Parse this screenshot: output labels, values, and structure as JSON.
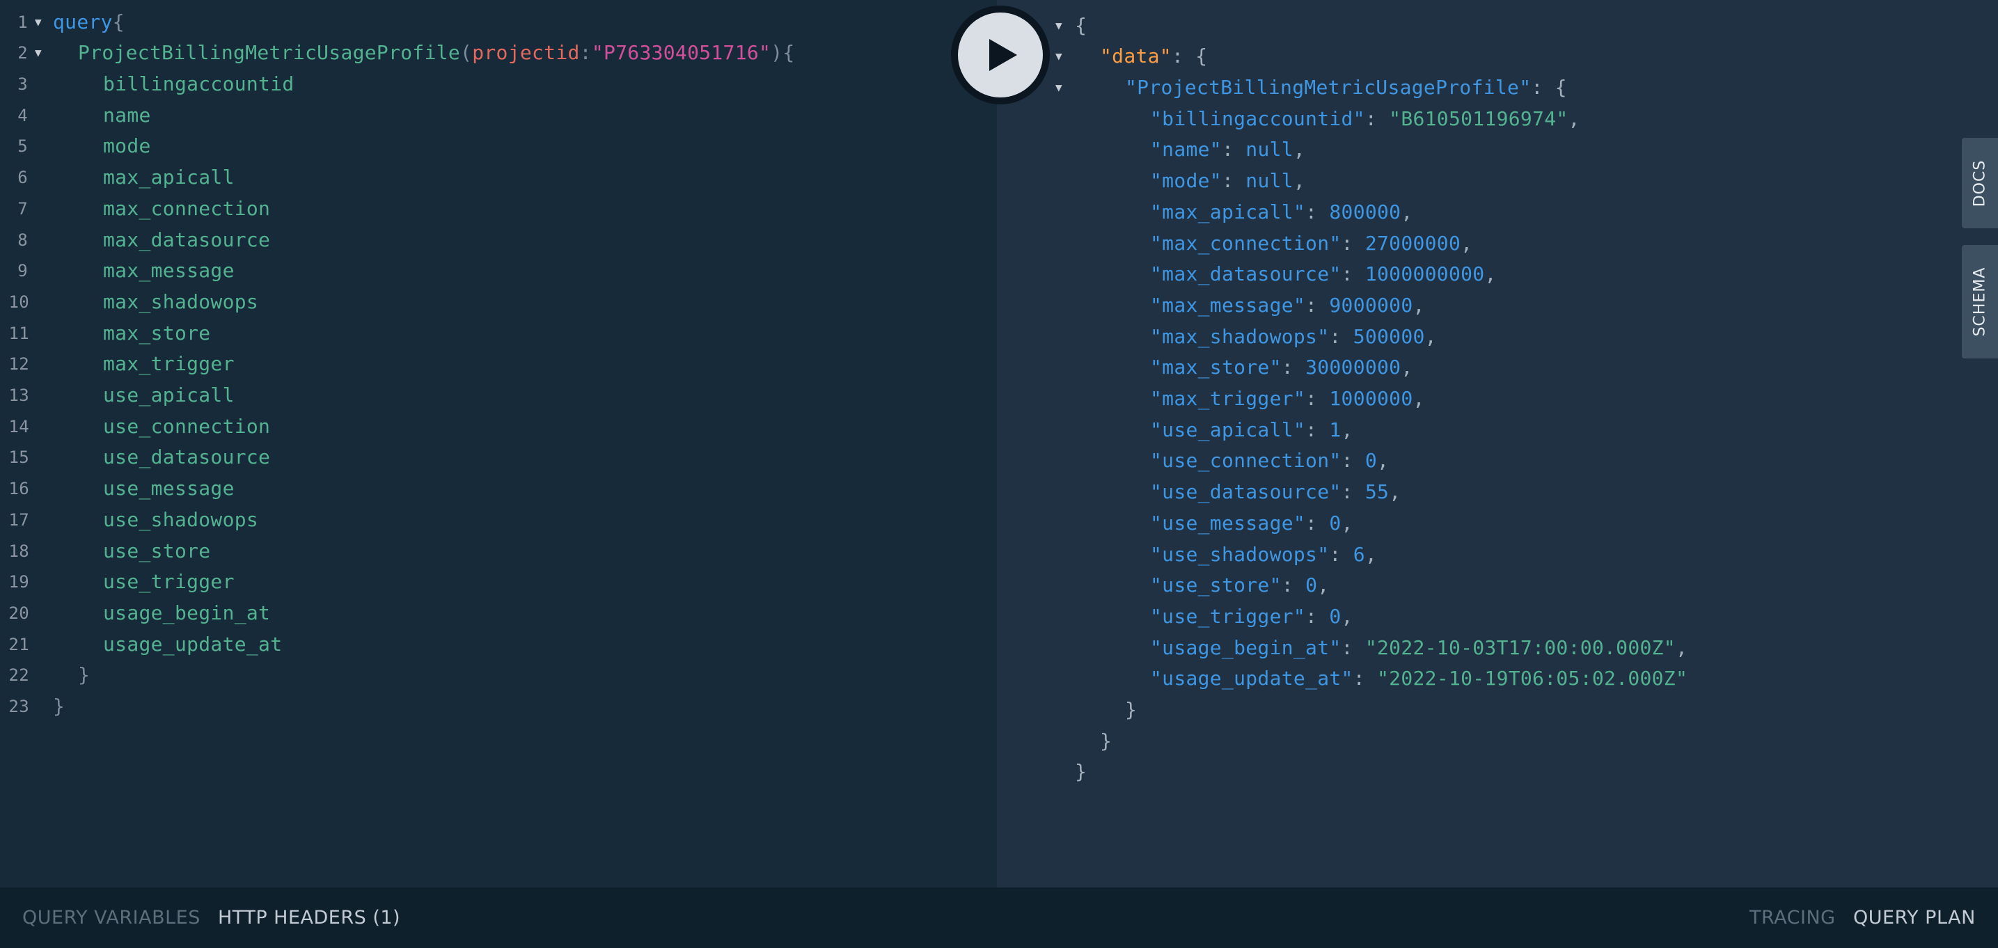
{
  "editor": {
    "lines": [
      {
        "n": "1",
        "fold": true,
        "indent": 0,
        "tokens": [
          [
            "kw",
            "query"
          ],
          [
            "punc",
            "{"
          ]
        ]
      },
      {
        "n": "2",
        "fold": true,
        "indent": 1,
        "tokens": [
          [
            "fn",
            "ProjectBillingMetricUsageProfile"
          ],
          [
            "punc",
            "("
          ],
          [
            "arg",
            "projectid"
          ],
          [
            "punc",
            ":"
          ],
          [
            "str",
            "\"P763304051716\""
          ],
          [
            "punc",
            "){"
          ]
        ]
      },
      {
        "n": "3",
        "indent": 2,
        "tokens": [
          [
            "field",
            "billingaccountid"
          ]
        ]
      },
      {
        "n": "4",
        "indent": 2,
        "tokens": [
          [
            "field",
            "name"
          ]
        ]
      },
      {
        "n": "5",
        "indent": 2,
        "tokens": [
          [
            "field",
            "mode"
          ]
        ]
      },
      {
        "n": "6",
        "indent": 2,
        "tokens": [
          [
            "field",
            "max_apicall"
          ]
        ]
      },
      {
        "n": "7",
        "indent": 2,
        "tokens": [
          [
            "field",
            "max_connection"
          ]
        ]
      },
      {
        "n": "8",
        "indent": 2,
        "tokens": [
          [
            "field",
            "max_datasource"
          ]
        ]
      },
      {
        "n": "9",
        "indent": 2,
        "tokens": [
          [
            "field",
            "max_message"
          ]
        ]
      },
      {
        "n": "10",
        "indent": 2,
        "tokens": [
          [
            "field",
            "max_shadowops"
          ]
        ]
      },
      {
        "n": "11",
        "indent": 2,
        "tokens": [
          [
            "field",
            "max_store"
          ]
        ]
      },
      {
        "n": "12",
        "indent": 2,
        "tokens": [
          [
            "field",
            "max_trigger"
          ]
        ]
      },
      {
        "n": "13",
        "indent": 2,
        "tokens": [
          [
            "field",
            "use_apicall"
          ]
        ]
      },
      {
        "n": "14",
        "indent": 2,
        "tokens": [
          [
            "field",
            "use_connection"
          ]
        ]
      },
      {
        "n": "15",
        "indent": 2,
        "tokens": [
          [
            "field",
            "use_datasource"
          ]
        ]
      },
      {
        "n": "16",
        "indent": 2,
        "tokens": [
          [
            "field",
            "use_message"
          ]
        ]
      },
      {
        "n": "17",
        "indent": 2,
        "tokens": [
          [
            "field",
            "use_shadowops"
          ]
        ]
      },
      {
        "n": "18",
        "indent": 2,
        "tokens": [
          [
            "field",
            "use_store"
          ]
        ]
      },
      {
        "n": "19",
        "indent": 2,
        "tokens": [
          [
            "field",
            "use_trigger"
          ]
        ]
      },
      {
        "n": "20",
        "indent": 2,
        "tokens": [
          [
            "field",
            "usage_begin_at"
          ]
        ]
      },
      {
        "n": "21",
        "indent": 2,
        "tokens": [
          [
            "field",
            "usage_update_at"
          ]
        ]
      },
      {
        "n": "22",
        "indent": 1,
        "tokens": [
          [
            "punc",
            "}"
          ]
        ]
      },
      {
        "n": "23",
        "indent": 0,
        "tokens": [
          [
            "punc",
            "}"
          ]
        ]
      }
    ]
  },
  "results": {
    "lines": [
      {
        "fold": true,
        "indent": 0,
        "tokens": [
          [
            "rpunc",
            "{"
          ]
        ]
      },
      {
        "fold": true,
        "indent": 1,
        "tokens": [
          [
            "rkey-data",
            "\"data\""
          ],
          [
            "rpunc",
            ": {"
          ]
        ]
      },
      {
        "fold": true,
        "indent": 2,
        "tokens": [
          [
            "rkey",
            "\"ProjectBillingMetricUsageProfile\""
          ],
          [
            "rpunc",
            ": {"
          ]
        ]
      },
      {
        "indent": 3,
        "tokens": [
          [
            "rkey",
            "\"billingaccountid\""
          ],
          [
            "rpunc",
            ": "
          ],
          [
            "rstr",
            "\"B610501196974\""
          ],
          [
            "rpunc",
            ","
          ]
        ]
      },
      {
        "indent": 3,
        "tokens": [
          [
            "rkey",
            "\"name\""
          ],
          [
            "rpunc",
            ": "
          ],
          [
            "rnull",
            "null"
          ],
          [
            "rpunc",
            ","
          ]
        ]
      },
      {
        "indent": 3,
        "tokens": [
          [
            "rkey",
            "\"mode\""
          ],
          [
            "rpunc",
            ": "
          ],
          [
            "rnull",
            "null"
          ],
          [
            "rpunc",
            ","
          ]
        ]
      },
      {
        "indent": 3,
        "tokens": [
          [
            "rkey",
            "\"max_apicall\""
          ],
          [
            "rpunc",
            ": "
          ],
          [
            "rnum",
            "800000"
          ],
          [
            "rpunc",
            ","
          ]
        ]
      },
      {
        "indent": 3,
        "tokens": [
          [
            "rkey",
            "\"max_connection\""
          ],
          [
            "rpunc",
            ": "
          ],
          [
            "rnum",
            "27000000"
          ],
          [
            "rpunc",
            ","
          ]
        ]
      },
      {
        "indent": 3,
        "tokens": [
          [
            "rkey",
            "\"max_datasource\""
          ],
          [
            "rpunc",
            ": "
          ],
          [
            "rnum",
            "1000000000"
          ],
          [
            "rpunc",
            ","
          ]
        ]
      },
      {
        "indent": 3,
        "tokens": [
          [
            "rkey",
            "\"max_message\""
          ],
          [
            "rpunc",
            ": "
          ],
          [
            "rnum",
            "9000000"
          ],
          [
            "rpunc",
            ","
          ]
        ]
      },
      {
        "indent": 3,
        "tokens": [
          [
            "rkey",
            "\"max_shadowops\""
          ],
          [
            "rpunc",
            ": "
          ],
          [
            "rnum",
            "500000"
          ],
          [
            "rpunc",
            ","
          ]
        ]
      },
      {
        "indent": 3,
        "tokens": [
          [
            "rkey",
            "\"max_store\""
          ],
          [
            "rpunc",
            ": "
          ],
          [
            "rnum",
            "30000000"
          ],
          [
            "rpunc",
            ","
          ]
        ]
      },
      {
        "indent": 3,
        "tokens": [
          [
            "rkey",
            "\"max_trigger\""
          ],
          [
            "rpunc",
            ": "
          ],
          [
            "rnum",
            "1000000"
          ],
          [
            "rpunc",
            ","
          ]
        ]
      },
      {
        "indent": 3,
        "tokens": [
          [
            "rkey",
            "\"use_apicall\""
          ],
          [
            "rpunc",
            ": "
          ],
          [
            "rnum",
            "1"
          ],
          [
            "rpunc",
            ","
          ]
        ]
      },
      {
        "indent": 3,
        "tokens": [
          [
            "rkey",
            "\"use_connection\""
          ],
          [
            "rpunc",
            ": "
          ],
          [
            "rnum",
            "0"
          ],
          [
            "rpunc",
            ","
          ]
        ]
      },
      {
        "indent": 3,
        "tokens": [
          [
            "rkey",
            "\"use_datasource\""
          ],
          [
            "rpunc",
            ": "
          ],
          [
            "rnum",
            "55"
          ],
          [
            "rpunc",
            ","
          ]
        ]
      },
      {
        "indent": 3,
        "tokens": [
          [
            "rkey",
            "\"use_message\""
          ],
          [
            "rpunc",
            ": "
          ],
          [
            "rnum",
            "0"
          ],
          [
            "rpunc",
            ","
          ]
        ]
      },
      {
        "indent": 3,
        "tokens": [
          [
            "rkey",
            "\"use_shadowops\""
          ],
          [
            "rpunc",
            ": "
          ],
          [
            "rnum",
            "6"
          ],
          [
            "rpunc",
            ","
          ]
        ]
      },
      {
        "indent": 3,
        "tokens": [
          [
            "rkey",
            "\"use_store\""
          ],
          [
            "rpunc",
            ": "
          ],
          [
            "rnum",
            "0"
          ],
          [
            "rpunc",
            ","
          ]
        ]
      },
      {
        "indent": 3,
        "tokens": [
          [
            "rkey",
            "\"use_trigger\""
          ],
          [
            "rpunc",
            ": "
          ],
          [
            "rnum",
            "0"
          ],
          [
            "rpunc",
            ","
          ]
        ]
      },
      {
        "indent": 3,
        "tokens": [
          [
            "rkey",
            "\"usage_begin_at\""
          ],
          [
            "rpunc",
            ": "
          ],
          [
            "rstr",
            "\"2022-10-03T17:00:00.000Z\""
          ],
          [
            "rpunc",
            ","
          ]
        ]
      },
      {
        "indent": 3,
        "tokens": [
          [
            "rkey",
            "\"usage_update_at\""
          ],
          [
            "rpunc",
            ": "
          ],
          [
            "rstr",
            "\"2022-10-19T06:05:02.000Z\""
          ]
        ]
      },
      {
        "indent": 2,
        "tokens": [
          [
            "rpunc",
            "}"
          ]
        ]
      },
      {
        "indent": 1,
        "tokens": [
          [
            "rpunc",
            "}"
          ]
        ]
      },
      {
        "indent": 0,
        "tokens": [
          [
            "rpunc",
            "}"
          ]
        ]
      }
    ]
  },
  "toolbar": {
    "run_icon": "play-icon"
  },
  "side_tabs": {
    "docs": "DOCS",
    "schema": "SCHEMA"
  },
  "bottom_bar": {
    "query_variables": "QUERY VARIABLES",
    "http_headers": "HTTP HEADERS (1)",
    "tracing": "TRACING",
    "query_plan": "QUERY PLAN"
  },
  "colors": {
    "editor_bg": "#172a3a",
    "results_bg": "#1f3143",
    "bottom_bg": "#0f202d",
    "keyword": "#3f96e2",
    "field": "#53b290",
    "argument": "#e4685b",
    "string_arg": "#d44f9a",
    "data_key": "#fd9c40"
  }
}
